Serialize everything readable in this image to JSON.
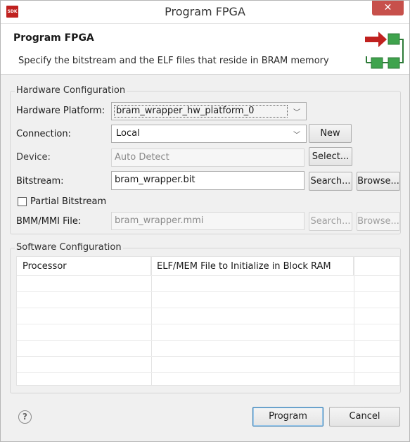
{
  "window": {
    "title": "Program FPGA",
    "app_icon_text": "SDK",
    "close_glyph": "✕"
  },
  "banner": {
    "title": "Program FPGA",
    "description": "Specify the bitstream and the ELF files that reside in BRAM memory",
    "graphic_icon": "fpga-program-icon"
  },
  "hardware": {
    "group_label": "Hardware Configuration",
    "platform_label": "Hardware Platform:",
    "platform_value": "bram_wrapper_hw_platform_0",
    "connection_label": "Connection:",
    "connection_value": "Local",
    "new_button": "New",
    "device_label": "Device:",
    "device_value": "Auto Detect",
    "select_button": "Select...",
    "bitstream_label": "Bitstream:",
    "bitstream_value": "bram_wrapper.bit",
    "bitstream_search_button": "Search...",
    "bitstream_browse_button": "Browse...",
    "partial_label": "Partial Bitstream",
    "partial_checked": false,
    "bmm_label": "BMM/MMI File:",
    "bmm_value": "bram_wrapper.mmi",
    "bmm_search_button": "Search...",
    "bmm_browse_button": "Browse..."
  },
  "software": {
    "group_label": "Software Configuration",
    "columns": [
      "Processor",
      "ELF/MEM File to Initialize in Block RAM",
      ""
    ],
    "rows": [
      [
        "",
        "",
        ""
      ],
      [
        "",
        "",
        ""
      ],
      [
        "",
        "",
        ""
      ],
      [
        "",
        "",
        ""
      ],
      [
        "",
        "",
        ""
      ],
      [
        "",
        "",
        ""
      ],
      [
        "",
        "",
        ""
      ]
    ]
  },
  "footer": {
    "help_glyph": "?",
    "program_button": "Program",
    "cancel_button": "Cancel"
  },
  "colors": {
    "close_button": "#c7504b",
    "program_arrow_red": "#c0211f",
    "program_chip_green": "#3fa34d"
  }
}
